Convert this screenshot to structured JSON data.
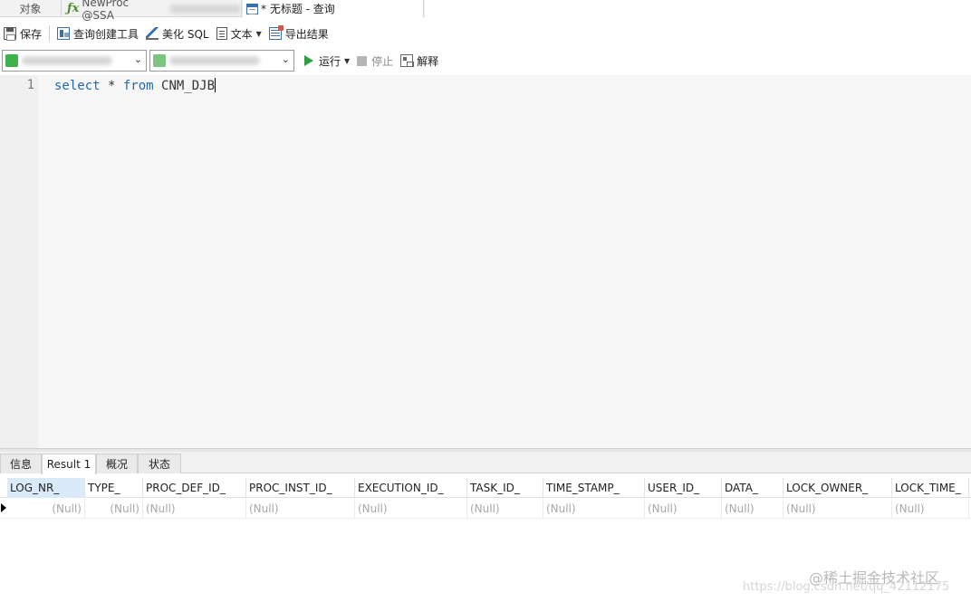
{
  "tabs": {
    "objects": "对象",
    "proc": "NewProc @SSA",
    "query": "* 无标题 - 查询"
  },
  "toolbar1": {
    "save": "保存",
    "query_builder": "查询创建工具",
    "beautify": "美化 SQL",
    "text": "文本",
    "export": "导出结果"
  },
  "toolbar2": {
    "run": "运行",
    "stop": "停止",
    "explain": "解释"
  },
  "editor": {
    "line_number": "1",
    "kw_select": "select",
    "star": " * ",
    "kw_from": "from",
    "table": " CNM_DJB"
  },
  "result_tabs": [
    "信息",
    "Result 1",
    "概况",
    "状态"
  ],
  "grid": {
    "columns": [
      "LOG_NR_",
      "TYPE_",
      "PROC_DEF_ID_",
      "PROC_INST_ID_",
      "EXECUTION_ID_",
      "TASK_ID_",
      "TIME_STAMP_",
      "USER_ID_",
      "DATA_",
      "LOCK_OWNER_",
      "LOCK_TIME_"
    ],
    "row": [
      "(Null)",
      "(Null)",
      "(Null)",
      "(Null)",
      "(Null)",
      "(Null)",
      "(Null)",
      "(Null)",
      "(Null)",
      "(Null)",
      "(Null)"
    ]
  },
  "watermark": {
    "brand": "@稀土掘金技术社区",
    "url": "https://blog.csdn.net/qq_42112175"
  },
  "icons": {
    "save": "save-icon",
    "query_builder": "query-builder-icon",
    "beautify": "beautify-sql-icon",
    "text": "text-icon",
    "export": "export-icon",
    "run": "play-icon",
    "stop": "stop-icon",
    "explain": "explain-icon"
  }
}
